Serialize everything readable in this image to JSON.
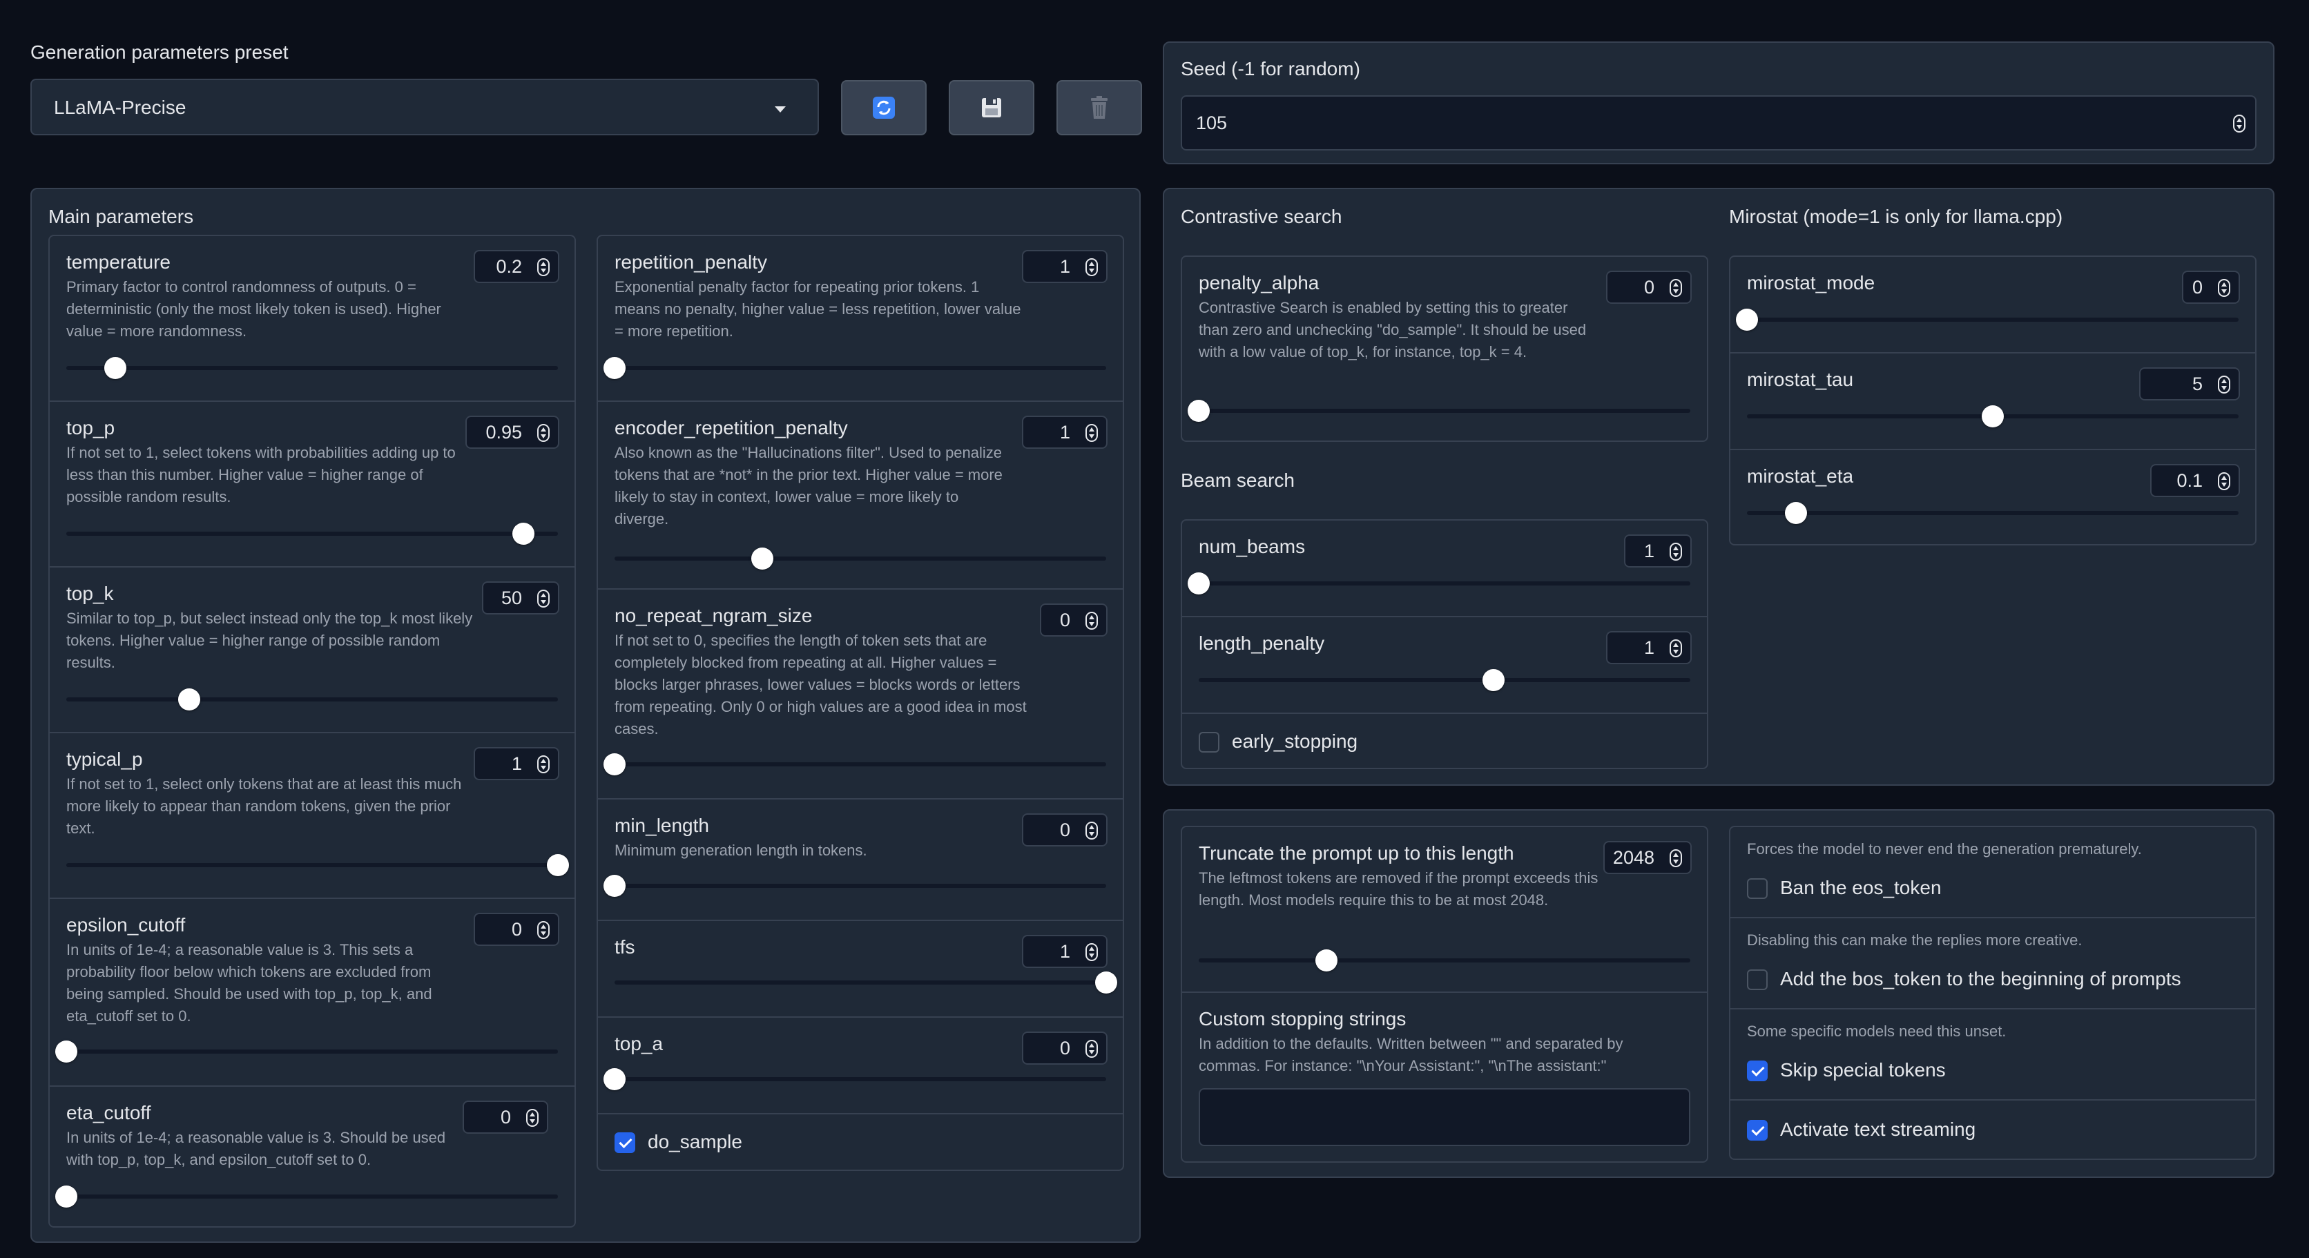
{
  "preset": {
    "label": "Generation parameters preset",
    "value": "LLaMA-Precise",
    "buttons": {
      "refresh": "refresh-icon",
      "save": "save-icon",
      "delete": "trash-icon"
    }
  },
  "seed": {
    "label": "Seed (-1 for random)",
    "value": "105"
  },
  "main": {
    "title": "Main parameters",
    "left": [
      {
        "id": "temperature",
        "label": "temperature",
        "value": "0.2",
        "info": "Primary factor to control randomness of outputs. 0 = deterministic (only the most likely token is used). Higher value = more randomness.",
        "level": 0.1
      },
      {
        "id": "top_p",
        "label": "top_p",
        "value": "0.95",
        "info": "If not set to 1, select tokens with probabilities adding up to less than this number. Higher value = higher range of possible random results.",
        "level": 0.93
      },
      {
        "id": "top_k",
        "label": "top_k",
        "value": "50",
        "info": "Similar to top_p, but select instead only the top_k most likely tokens. Higher value = higher range of possible random results.",
        "level": 0.25
      },
      {
        "id": "typical_p",
        "label": "typical_p",
        "value": "1",
        "info": "If not set to 1, select only tokens that are at least this much more likely to appear than random tokens, given the prior text.",
        "level": 1.0
      },
      {
        "id": "epsilon_cutoff",
        "label": "epsilon_cutoff",
        "value": "0",
        "info": "In units of 1e-4; a reasonable value is 3. This sets a probability floor below which tokens are excluded from being sampled. Should be used with top_p, top_k, and eta_cutoff set to 0.",
        "level": 0
      },
      {
        "id": "eta_cutoff",
        "label": "eta_cutoff",
        "value": "0",
        "info": "In units of 1e-4; a reasonable value is 3. Should be used with top_p, top_k, and epsilon_cutoff set to 0.",
        "level": 0
      }
    ],
    "right": [
      {
        "id": "repetition_penalty",
        "label": "repetition_penalty",
        "value": "1",
        "info": "Exponential penalty factor for repeating prior tokens. 1 means no penalty, higher value = less repetition, lower value = more repetition.",
        "level": 0
      },
      {
        "id": "encoder_repetition_penalty",
        "label": "encoder_repetition_penalty",
        "value": "1",
        "info": "Also known as the \"Hallucinations filter\". Used to penalize tokens that are *not* in the prior text. Higher value = more likely to stay in context, lower value = more likely to diverge.",
        "level": 0.3
      },
      {
        "id": "no_repeat_ngram_size",
        "label": "no_repeat_ngram_size",
        "value": "0",
        "info": "If not set to 0, specifies the length of token sets that are completely blocked from repeating at all. Higher values = blocks larger phrases, lower values = blocks words or letters from repeating. Only 0 or high values are a good idea in most cases.",
        "level": 0
      },
      {
        "id": "min_length",
        "label": "min_length",
        "value": "0",
        "info": "Minimum generation length in tokens.",
        "level": 0
      },
      {
        "id": "tfs",
        "label": "tfs",
        "value": "1",
        "info": "",
        "level": 1.0
      },
      {
        "id": "top_a",
        "label": "top_a",
        "value": "0",
        "info": "",
        "level": 0
      }
    ],
    "do_sample": {
      "label": "do_sample",
      "checked": true
    }
  },
  "contrastive": {
    "title": "Contrastive search",
    "penalty_alpha": {
      "label": "penalty_alpha",
      "value": "0",
      "info": "Contrastive Search is enabled by setting this to greater than zero and unchecking \"do_sample\". It should be used with a low value of top_k, for instance, top_k = 4.",
      "level": 0
    }
  },
  "beam": {
    "title": "Beam search",
    "num_beams": {
      "label": "num_beams",
      "value": "1",
      "level": 0
    },
    "length_penalty": {
      "label": "length_penalty",
      "value": "1",
      "level": 0.6
    },
    "early_stopping": {
      "label": "early_stopping",
      "checked": false
    }
  },
  "mirostat": {
    "title": "Mirostat (mode=1 is only for llama.cpp)",
    "items": [
      {
        "id": "mirostat_mode",
        "label": "mirostat_mode",
        "value": "0",
        "level": 0
      },
      {
        "id": "mirostat_tau",
        "label": "mirostat_tau",
        "value": "5",
        "level": 0.5
      },
      {
        "id": "mirostat_eta",
        "label": "mirostat_eta",
        "value": "0.1",
        "level": 0.1
      }
    ]
  },
  "truncate": {
    "label": "Truncate the prompt up to this length",
    "value": "2048",
    "info": "The leftmost tokens are removed if the prompt exceeds this length. Most models require this to be at most 2048.",
    "level": 0.26
  },
  "stopping": {
    "label": "Custom stopping strings",
    "info": "In addition to the defaults. Written between \"\" and separated by commas. For instance: \"\\nYour Assistant:\", \"\\nThe assistant:\"",
    "value": ""
  },
  "flags": {
    "ban_eos": {
      "info": "Forces the model to never end the generation prematurely.",
      "label": "Ban the eos_token",
      "checked": false
    },
    "add_bos": {
      "info": "Disabling this can make the replies more creative.",
      "label": "Add the bos_token to the beginning of prompts",
      "checked": false
    },
    "skip_special": {
      "info": "Some specific models need this unset.",
      "label": "Skip special tokens",
      "checked": true
    },
    "streaming": {
      "label": "Activate text streaming",
      "checked": true
    }
  }
}
